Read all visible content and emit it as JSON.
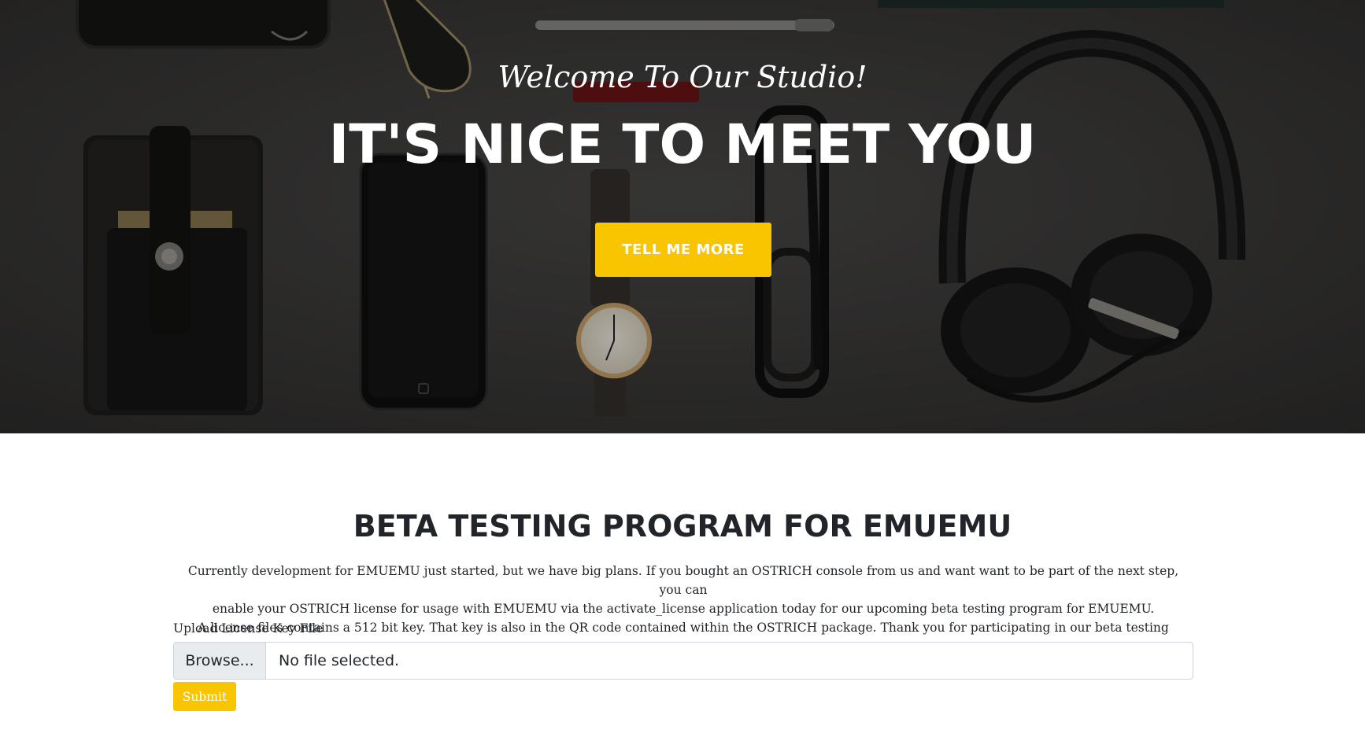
{
  "hero": {
    "welcome": "Welcome To Our Studio!",
    "heading": "IT'S NICE TO MEET YOU",
    "button_label": "TELL ME MORE"
  },
  "section": {
    "title": "BETA TESTING PROGRAM FOR EMUEMU",
    "desc_line1": "Currently development for EMUEMU just started, but we have big plans. If you bought an OSTRICH console from us and want want to be part of the next step, you can",
    "desc_line2": "enable your OSTRICH license for usage with EMUEMU via the activate_license application today for our upcoming beta testing program for EMUEMU.",
    "desc_line3": "A license files contains a 512 bit key. That key is also in the QR code contained within the OSTRICH package. Thank you for participating in our beta testing program.",
    "upload_label": "Upload License Key File",
    "browse_label": "Browse...",
    "file_status": "No file selected.",
    "submit_label": "Submit"
  },
  "colors": {
    "accent": "#f9c400",
    "text": "#212529",
    "hero_background": "#3c3b3a"
  }
}
